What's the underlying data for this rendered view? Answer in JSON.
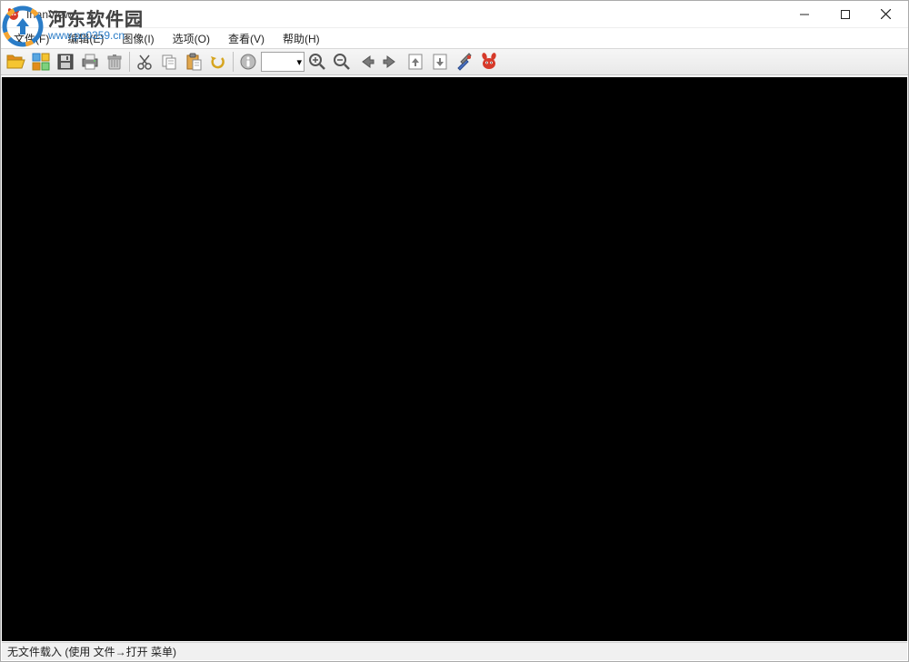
{
  "window": {
    "title": "IrfanView"
  },
  "menu": {
    "file": "文件(F)",
    "edit": "编辑(E)",
    "image": "图像(I)",
    "options": "选项(O)",
    "view": "查看(V)",
    "help": "帮助(H)"
  },
  "toolbar": {
    "open": "open",
    "thumbnails": "thumbnails",
    "save": "save",
    "print": "print",
    "delete": "delete",
    "cut": "cut",
    "copy": "copy",
    "paste": "paste",
    "undo": "undo",
    "info": "info",
    "zoom_dropdown_icon": "▾",
    "zoom_in": "zoom-in",
    "zoom_out": "zoom-out",
    "prev": "previous",
    "next": "next",
    "first": "first-page",
    "last": "last-page",
    "settings": "settings",
    "about": "about"
  },
  "statusbar": {
    "text": "无文件载入 (使用 文件→打开 菜单)"
  },
  "watermark": {
    "text_cn": "河东软件园",
    "url": "www.pc0359.cn"
  },
  "colors": {
    "folder_yellow": "#f5c531",
    "folder_orange": "#e28c1b",
    "blue": "#2a7cc7",
    "grey_arrow": "#7a7a7a",
    "red": "#d63a2a"
  }
}
